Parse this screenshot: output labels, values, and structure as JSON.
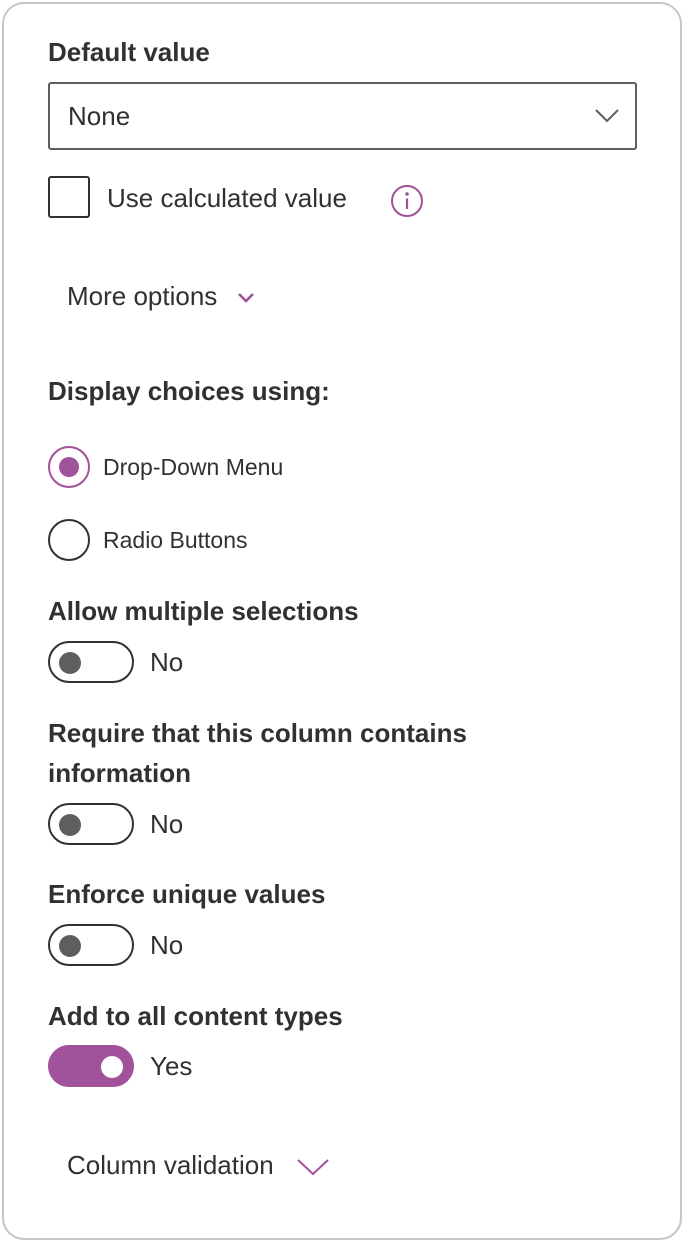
{
  "default_value": {
    "label": "Default value",
    "selected": "None"
  },
  "calculated": {
    "label": "Use calculated value",
    "checked": false,
    "info_icon": "info-icon"
  },
  "more_options": {
    "label": "More options",
    "icon": "chevron-down-icon"
  },
  "display_choices": {
    "label": "Display choices using:",
    "options": [
      {
        "label": "Drop-Down Menu",
        "selected": true
      },
      {
        "label": "Radio Buttons",
        "selected": false
      }
    ]
  },
  "toggles": [
    {
      "label": "Allow multiple selections",
      "state": "No",
      "on": false
    },
    {
      "label_line1": "Require that this column contains",
      "label_line2": "information",
      "state": "No",
      "on": false
    },
    {
      "label": "Enforce unique values",
      "state": "No",
      "on": false
    },
    {
      "label": "Add to all content types",
      "state": "Yes",
      "on": true
    }
  ],
  "column_validation": {
    "label": "Column validation",
    "icon": "chevron-down-icon"
  },
  "colors": {
    "accent": "#a0529a",
    "text": "#323130",
    "border": "#605e5c"
  }
}
